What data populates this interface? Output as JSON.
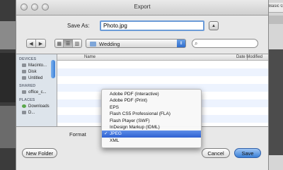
{
  "window": {
    "title": "Export"
  },
  "background_app": {
    "fragment_text": "Basic Grap"
  },
  "save_as": {
    "label": "Save As:",
    "value": "Photo.jpg",
    "disclosure_glyph": "▲"
  },
  "toolbar": {
    "back_glyph": "◀",
    "forward_glyph": "▶",
    "view_icons": [
      "▦",
      "☰",
      "▥"
    ],
    "location": "Wedding",
    "location_arrows": "⇕",
    "search_placeholder": "",
    "search_glyph": "⌕"
  },
  "sidebar": {
    "devices_header": "DEVICES",
    "devices": [
      "Macinto...",
      "Disk",
      "Untitled"
    ],
    "shared_header": "SHARED",
    "shared": [
      "office_c..."
    ],
    "places_header": "PLACES",
    "places": [
      "Downloads",
      "D..."
    ]
  },
  "file_list": {
    "col_name": "Name",
    "col_date": "Date Modified"
  },
  "format": {
    "label": "Format",
    "options": [
      "Adobe PDF (Interactive)",
      "Adobe PDF (Print)",
      "EPS",
      "Flash CS5 Professional (FLA)",
      "Flash Player (SWF)",
      "InDesign Markup (IDML)",
      "JPEG",
      "XML"
    ],
    "selected": "JPEG",
    "check": "✓"
  },
  "buttons": {
    "new_folder": "New Folder",
    "cancel": "Cancel",
    "save": "Save"
  },
  "colors": {
    "accent": "#3a7fd6",
    "selection": "#2f62d2",
    "sidebar_bg": "#dde4eb"
  }
}
